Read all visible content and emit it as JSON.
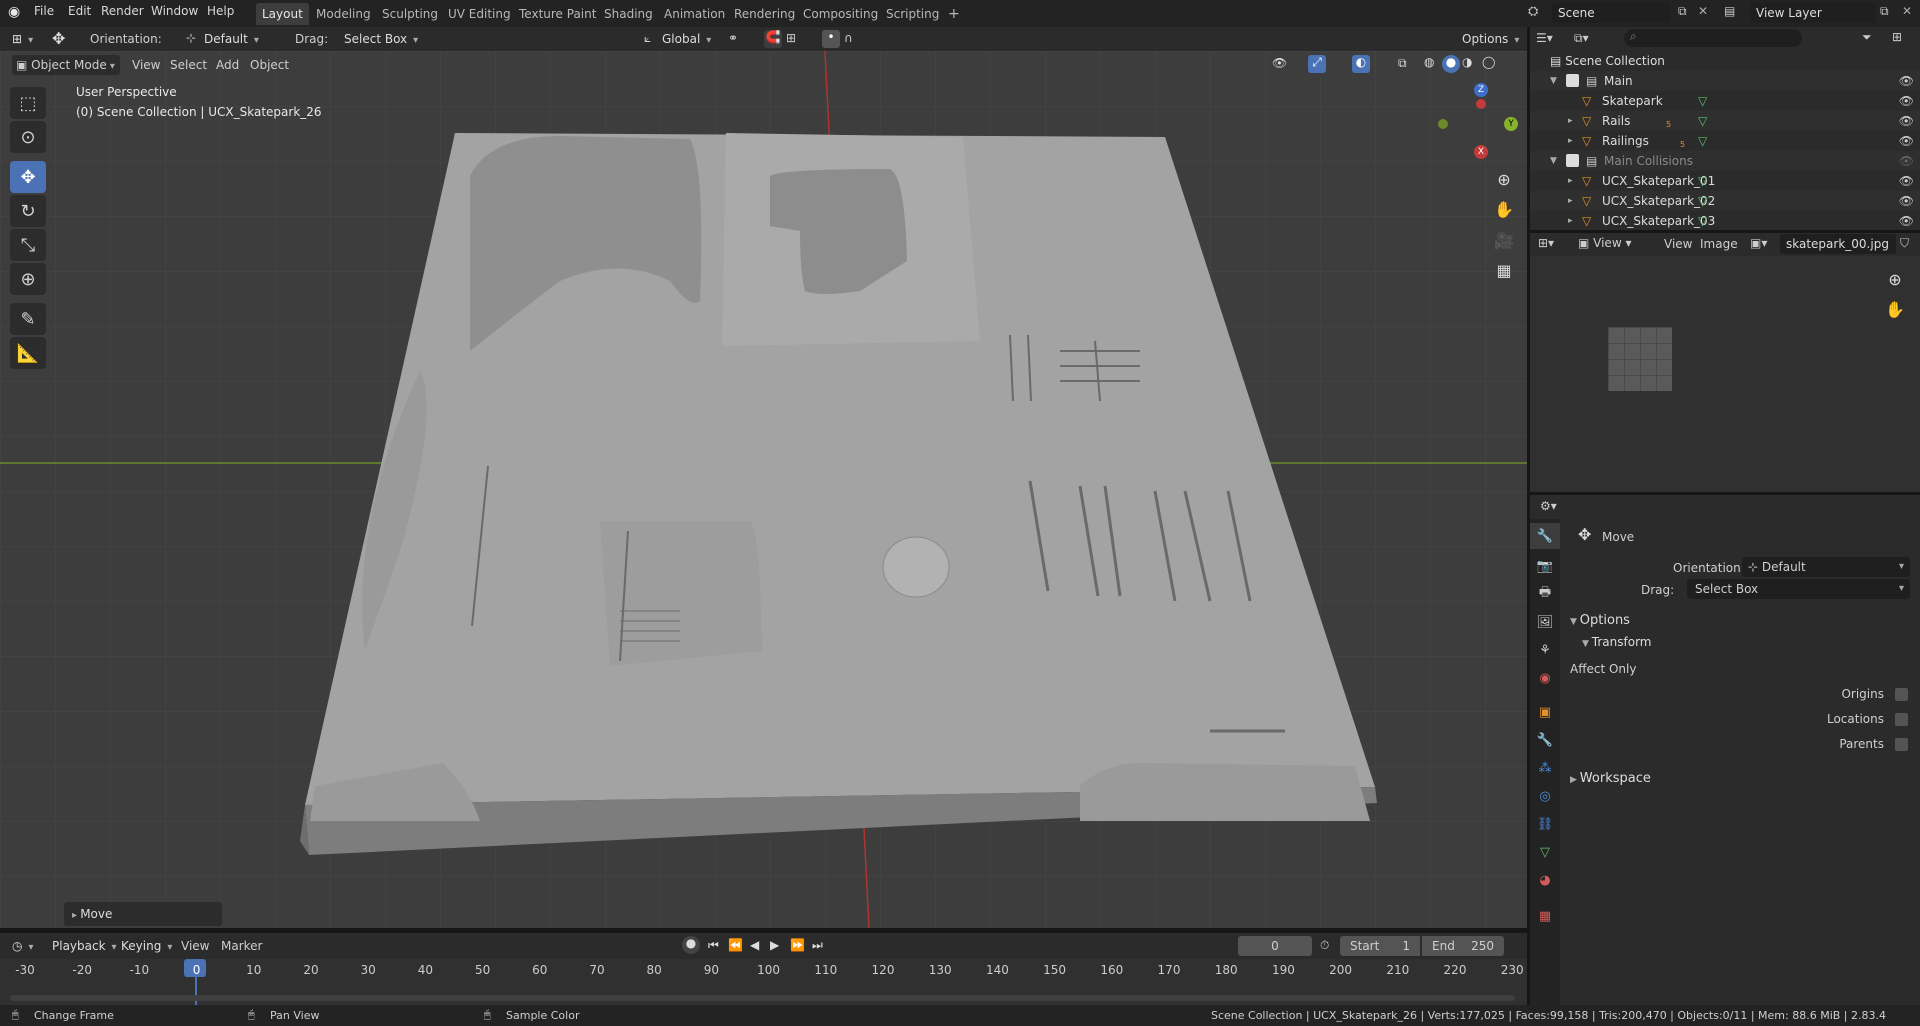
{
  "topbar": {
    "menus": [
      "File",
      "Edit",
      "Render",
      "Window",
      "Help"
    ],
    "workspaces": [
      "Layout",
      "Modeling",
      "Sculpting",
      "UV Editing",
      "Texture Paint",
      "Shading",
      "Animation",
      "Rendering",
      "Compositing",
      "Scripting"
    ],
    "active_workspace": "Layout",
    "add_tab": "+",
    "scene": "Scene",
    "view_layer": "View Layer"
  },
  "tool_header": {
    "orientation_label": "Orientation:",
    "orientation_value": "Default",
    "drag_label": "Drag:",
    "drag_value": "Select Box",
    "transform_orientation": "Global",
    "options": "Options"
  },
  "viewport_header": {
    "mode": "Object Mode",
    "menus": [
      "View",
      "Select",
      "Add",
      "Object"
    ]
  },
  "viewport": {
    "perspective": "User Perspective",
    "collection_info": "(0) Scene Collection | UCX_Skatepark_26",
    "gizmo": {
      "z": "Z",
      "y": "Y",
      "x": "X"
    },
    "last_op": "Move"
  },
  "outliner": {
    "search_placeholder": "",
    "root": "Scene Collection",
    "rows": [
      {
        "name": "Main",
        "level": 1
      },
      {
        "name": "Skatepark",
        "level": 2
      },
      {
        "name": "Rails",
        "level": 2
      },
      {
        "name": "Railings",
        "level": 2
      },
      {
        "name": "Main Collisions",
        "level": 1
      },
      {
        "name": "UCX_Skatepark_01",
        "level": 2
      },
      {
        "name": "UCX_Skatepark_02",
        "level": 2
      },
      {
        "name": "UCX_Skatepark_03",
        "level": 2
      }
    ],
    "rails_count": "5",
    "railings_count": "5"
  },
  "image_editor": {
    "view_dd": "View",
    "menus": [
      "View",
      "Image"
    ],
    "image_name": "skatepark_00.jpg"
  },
  "properties": {
    "tool_name": "Move",
    "orientation_label": "Orientation",
    "orientation_value": "Default",
    "drag_label": "Drag:",
    "drag_value": "Select Box",
    "options_panel": "Options",
    "transform_panel": "Transform",
    "affect_only": "Affect Only",
    "origins": "Origins",
    "locations": "Locations",
    "parents": "Parents",
    "workspace_panel": "Workspace"
  },
  "timeline": {
    "menus": [
      "Playback",
      "Keying",
      "View",
      "Marker"
    ],
    "current_frame": "0",
    "start_label": "Start",
    "start_value": "1",
    "end_label": "End",
    "end_value": "250",
    "ticks": [
      "-30",
      "-20",
      "-10",
      "0",
      "10",
      "20",
      "30",
      "40",
      "50",
      "60",
      "70",
      "80",
      "90",
      "100",
      "110",
      "120",
      "130",
      "140",
      "150",
      "160",
      "170",
      "180",
      "190",
      "200",
      "210",
      "220",
      "230"
    ]
  },
  "statusbar": {
    "left1": "Change Frame",
    "left2": "Pan View",
    "left3": "Sample Color",
    "right": "Scene Collection | UCX_Skatepark_26 | Verts:177,025 | Faces:99,158 | Tris:200,470 | Objects:0/11 | Mem: 88.6 MiB | 2.83.4"
  },
  "colors": {
    "accent": "#4a72b5",
    "axis_x": "#c33b3b",
    "axis_y": "#7aa52a"
  }
}
